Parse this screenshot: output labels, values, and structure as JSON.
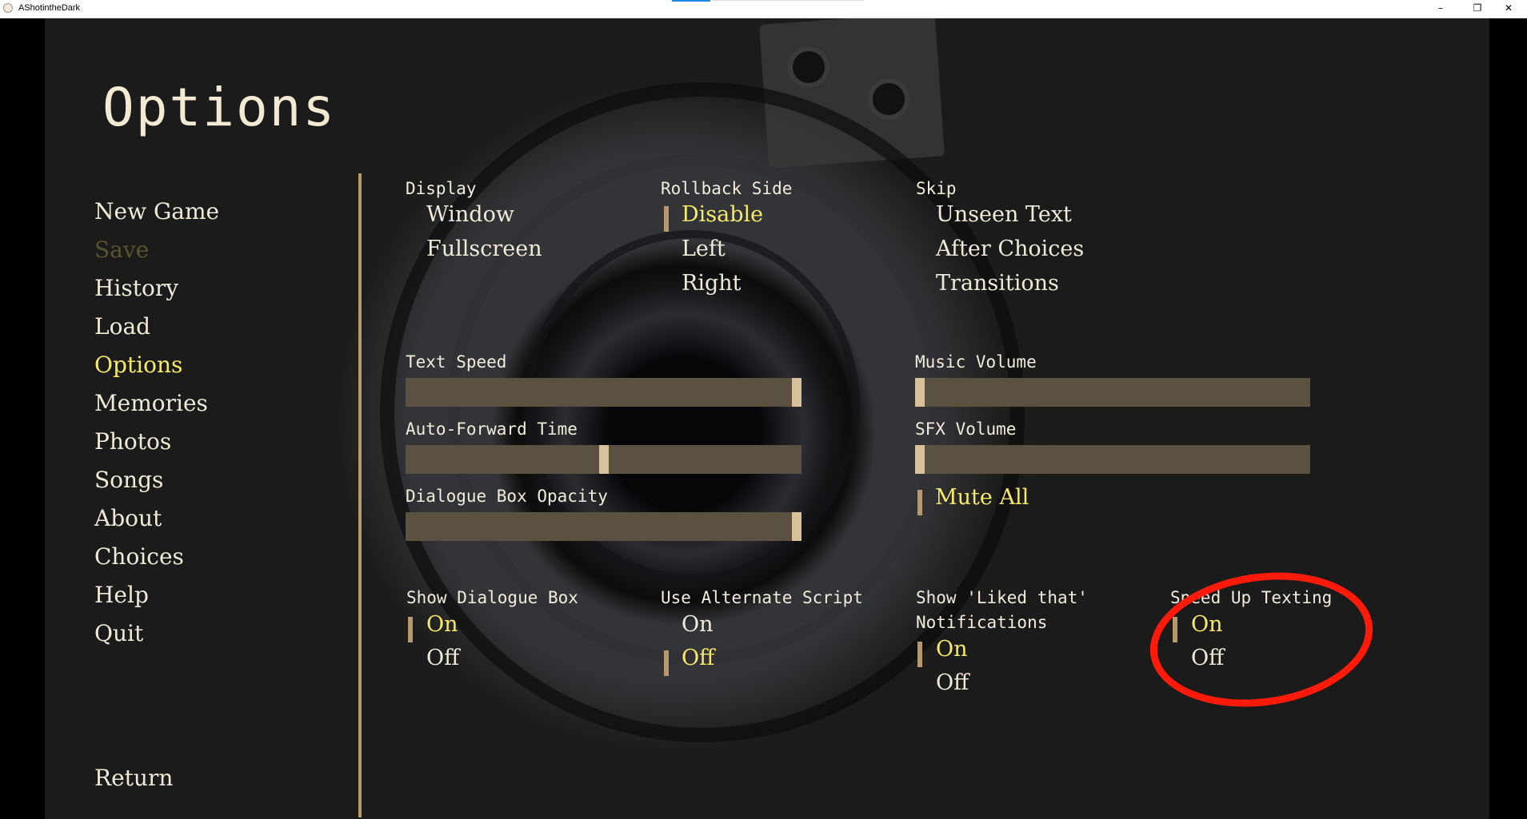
{
  "window": {
    "title": "AShotintheDark",
    "minimize_glyph": "–",
    "maximize_glyph": "❐",
    "close_glyph": "✕"
  },
  "screen": {
    "title": "Options"
  },
  "nav": {
    "items": [
      {
        "label": "New Game",
        "state": "normal"
      },
      {
        "label": "Save",
        "state": "disabled"
      },
      {
        "label": "History",
        "state": "normal"
      },
      {
        "label": "Load",
        "state": "normal"
      },
      {
        "label": "Options",
        "state": "active"
      },
      {
        "label": "Memories",
        "state": "normal"
      },
      {
        "label": "Photos",
        "state": "normal"
      },
      {
        "label": "Songs",
        "state": "normal"
      },
      {
        "label": "About",
        "state": "normal"
      },
      {
        "label": "Choices",
        "state": "normal"
      },
      {
        "label": "Help",
        "state": "normal"
      },
      {
        "label": "Quit",
        "state": "normal"
      }
    ],
    "return_label": "Return"
  },
  "display": {
    "label": "Display",
    "options": [
      "Window",
      "Fullscreen"
    ],
    "selected": null
  },
  "rollback": {
    "label": "Rollback Side",
    "options": [
      "Disable",
      "Left",
      "Right"
    ],
    "selected": "Disable"
  },
  "skip": {
    "label": "Skip",
    "options": [
      "Unseen Text",
      "After Choices",
      "Transitions"
    ],
    "selected": null
  },
  "sliders": {
    "text_speed": {
      "label": "Text Speed",
      "value": 1.0
    },
    "auto_forward": {
      "label": "Auto-Forward Time",
      "value": 0.5
    },
    "dialogue_opacity": {
      "label": "Dialogue Box Opacity",
      "value": 1.0
    },
    "music_volume": {
      "label": "Music Volume",
      "value": 0.0
    },
    "sfx_volume": {
      "label": "SFX Volume",
      "value": 0.0
    }
  },
  "mute_all": {
    "label": "Mute All",
    "selected": true
  },
  "show_dialogue_box": {
    "label": "Show Dialogue Box",
    "on": "On",
    "off": "Off",
    "selected": "On"
  },
  "alternate_script": {
    "label": "Use Alternate Script",
    "on": "On",
    "off": "Off",
    "selected": "Off"
  },
  "liked_notifications": {
    "label_line1": "Show 'Liked that'",
    "label_line2": "Notifications",
    "on": "On",
    "off": "Off",
    "selected": "On"
  },
  "speed_up_texting": {
    "label": "Speed Up Texting",
    "on": "On",
    "off": "Off",
    "selected": "On"
  },
  "colors": {
    "text": "#f0ead8",
    "selected": "#f7ea6a",
    "disabled": "#5a5231",
    "accent": "#b8996d",
    "slider_track": "#5b5140",
    "slider_thumb": "#d8c09a",
    "annotation_circle": "#ff1a0a"
  }
}
